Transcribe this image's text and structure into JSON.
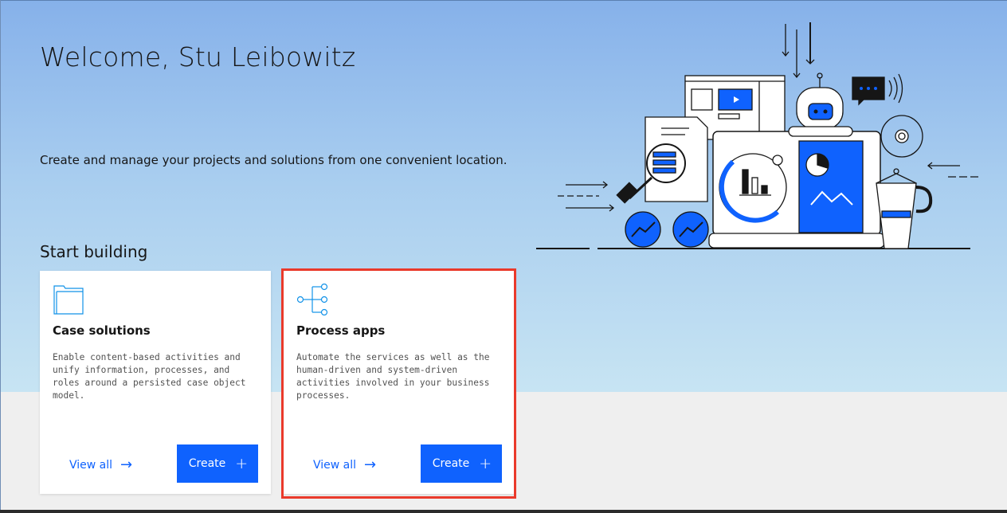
{
  "header": {
    "title": "Welcome, Stu Leibowitz",
    "subtitle": "Create and manage your projects and solutions from one convenient location."
  },
  "section": {
    "title": "Start building"
  },
  "cards": [
    {
      "title": "Case solutions",
      "description": "Enable content-based activities and unify information, processes, and roles around a persisted case object model.",
      "view_all_label": "View all",
      "create_label": "Create",
      "icon": "folder-icon"
    },
    {
      "title": "Process apps",
      "description": "Automate the services as well as the human-driven and system-driven activities involved in your business processes.",
      "view_all_label": "View all",
      "create_label": "Create",
      "icon": "flow-tree-icon",
      "highlighted": true
    }
  ],
  "colors": {
    "accent": "#0f62fe",
    "highlight": "#ea3a2b",
    "hero_top": "#86b1ea",
    "hero_bottom": "#c7e4f3"
  }
}
